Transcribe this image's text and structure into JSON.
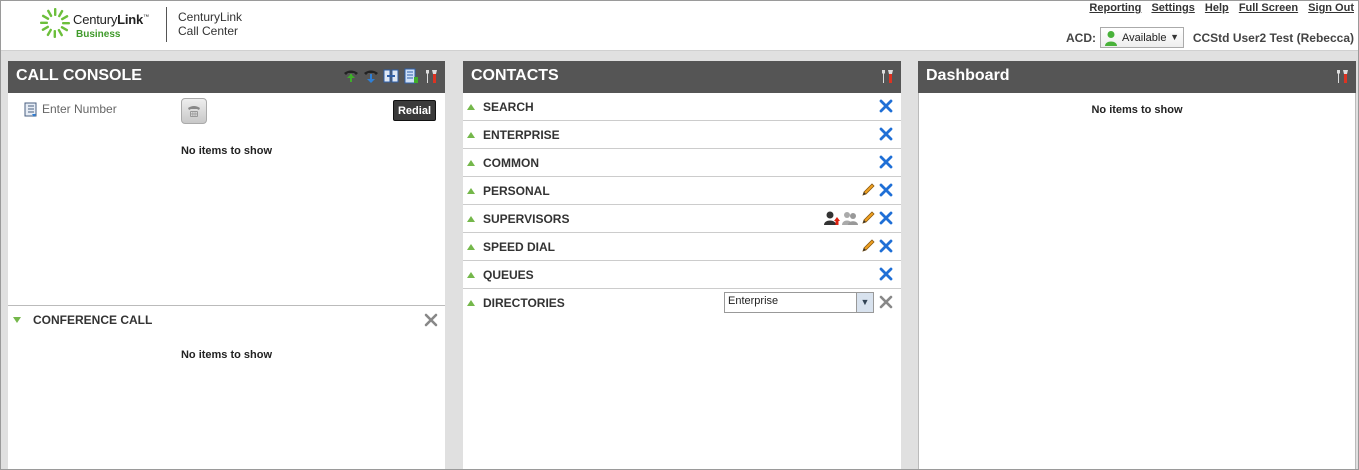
{
  "header": {
    "logo_word_plain": "Century",
    "logo_word_bold": "Link",
    "logo_tm": "™",
    "logo_sub": "Business",
    "product": "CenturyLink Call Center",
    "links": [
      "Reporting",
      "Settings",
      "Help",
      "Full Screen",
      "Sign Out"
    ],
    "acd_label": "ACD:",
    "acd_value": "Available",
    "user_name": "CCStd User2 Test (Rebecca)"
  },
  "call_console": {
    "title": "CALL CONSOLE",
    "number_placeholder": "Enter Number",
    "redial_label": "Redial",
    "empty_text": "No items to show",
    "tools": [
      "phone-green-icon",
      "phone-blue-icon",
      "transfer-icon",
      "directory-icon",
      "settings-tools-icon"
    ],
    "conference": {
      "title": "CONFERENCE CALL",
      "empty_text": "No items to show"
    }
  },
  "contacts": {
    "title": "CONTACTS",
    "rows": [
      {
        "label": "SEARCH"
      },
      {
        "label": "ENTERPRISE"
      },
      {
        "label": "COMMON"
      },
      {
        "label": "PERSONAL"
      },
      {
        "label": "SUPERVISORS"
      },
      {
        "label": "SPEED DIAL"
      },
      {
        "label": "QUEUES"
      },
      {
        "label": "DIRECTORIES"
      }
    ],
    "directory_value": "Enterprise"
  },
  "dashboard": {
    "title": "Dashboard",
    "empty_text": "No items to show"
  },
  "colors": {
    "panel_header": "#555555",
    "accent_green": "#74b74a",
    "close_blue": "#1f6fd6"
  }
}
